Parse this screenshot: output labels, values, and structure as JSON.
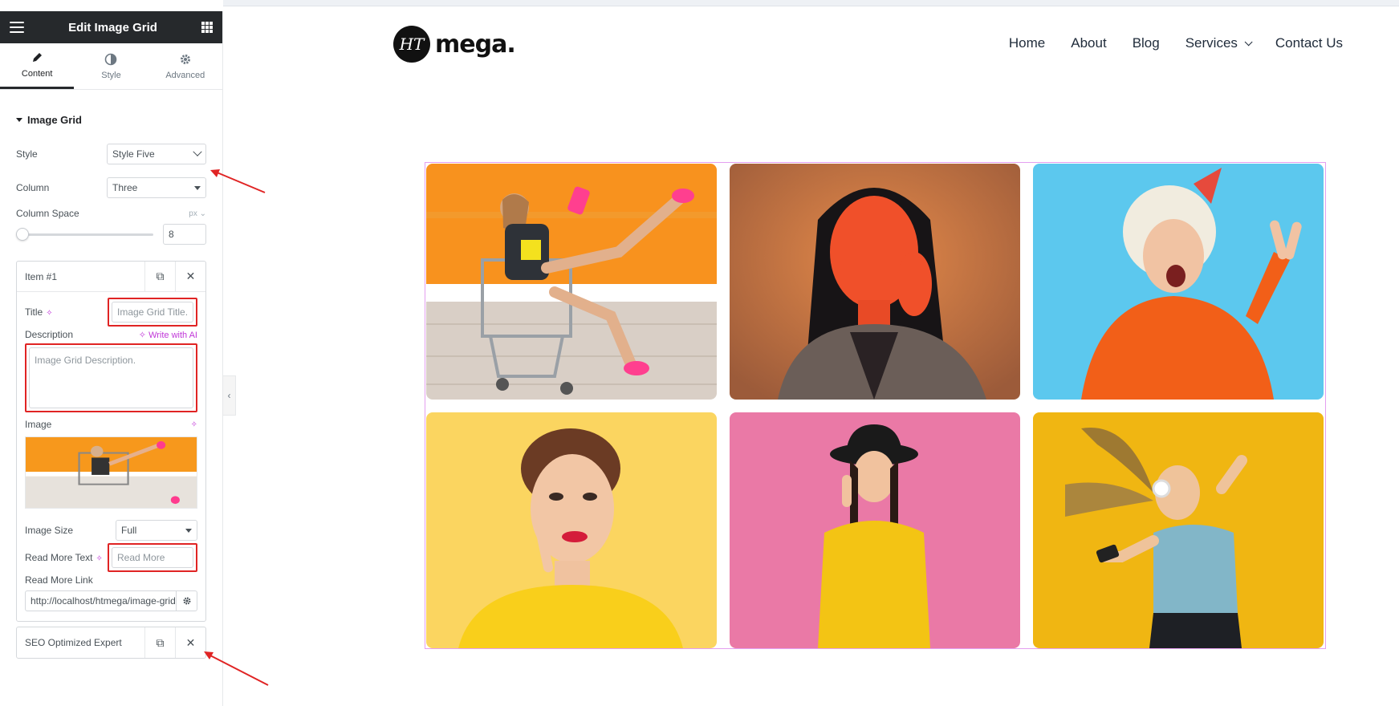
{
  "panel": {
    "title": "Edit Image Grid",
    "tabs": [
      {
        "label": "Content",
        "icon": "pencil-icon",
        "active": true
      },
      {
        "label": "Style",
        "icon": "contrast-icon",
        "active": false
      },
      {
        "label": "Advanced",
        "icon": "gear-icon",
        "active": false
      }
    ],
    "section": "Image Grid",
    "style": {
      "label": "Style",
      "value": "Style Five"
    },
    "column": {
      "label": "Column",
      "value": "Three"
    },
    "column_space": {
      "label": "Column Space",
      "unit": "px",
      "value": "8"
    },
    "item1": {
      "label": "Item #1",
      "title_label": "Title",
      "title_placeholder": "Image Grid Title.",
      "description_label": "Description",
      "write_ai": "Write with AI",
      "description_placeholder": "Image Grid Description.",
      "image_label": "Image",
      "image_size_label": "Image Size",
      "image_size_value": "Full",
      "read_more_text_label": "Read More Text",
      "read_more_text_value": "Read More",
      "read_more_link_label": "Read More Link",
      "read_more_link_value": "http://localhost/htmega/image-grid"
    },
    "item2": {
      "label": "SEO Optimized Expert"
    }
  },
  "site": {
    "logo_mark": "HT",
    "logo_text": "mega.",
    "nav": [
      "Home",
      "About",
      "Blog",
      "Services",
      "Contact Us"
    ]
  },
  "colors": {
    "panel_header": "#26292c",
    "ai_accent": "#c036d8",
    "highlight_red": "#e02424",
    "grid_border": "#e49ff0"
  }
}
